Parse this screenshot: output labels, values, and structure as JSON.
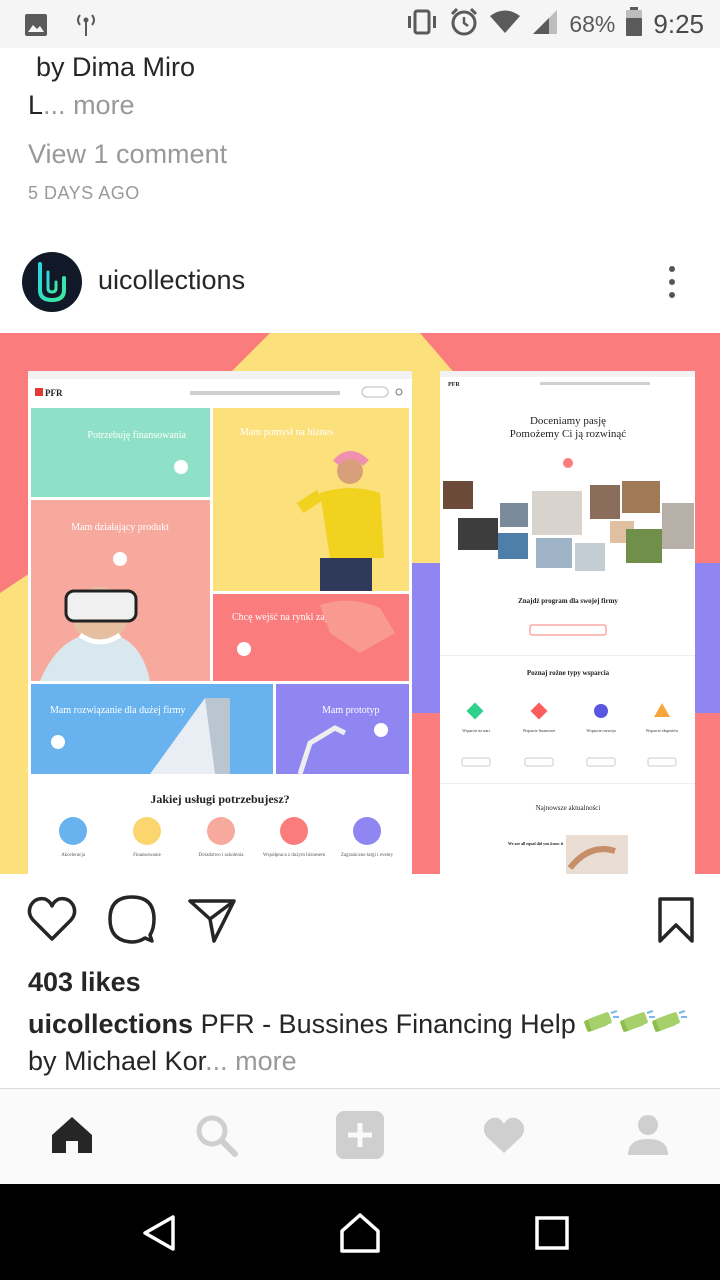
{
  "status_bar": {
    "battery": "68%",
    "time": "9:25",
    "icons": [
      "image-icon",
      "signal-antenna-icon",
      "vibrate-icon",
      "alarm-icon",
      "wifi-icon",
      "cell-signal-icon",
      "battery-icon"
    ]
  },
  "previous_post": {
    "author_line": "by Dima Miro",
    "truncated_text": "L",
    "ellipsis": "...",
    "more_label": "more",
    "view_comments": "View 1 comment",
    "age": "5 DAYS AGO"
  },
  "post": {
    "username": "uicollections",
    "likes": "403 likes",
    "caption_user": "uicollections",
    "caption_text": "PFR - Bussines Financing Help",
    "caption_line2": "by Michael Kor",
    "ellipsis": "...",
    "more_label": "more",
    "image": {
      "left_mockup": {
        "logo": "PFR",
        "tiles": [
          "Potrzebuję finansowania",
          "Mam pomysł na biznes",
          "Mam działający produkt",
          "Chcę wejść na rynki zagraniczne",
          "Mam rozwiązanie dla dużej firmy",
          "Mam prototyp"
        ],
        "question": "Jakiej usługi potrzebujesz?",
        "services": [
          "Akceleracja",
          "Finansowanie",
          "Doradztwo i szkolenia",
          "Współpraca z dużym biznesem",
          "Zagraniczne targi i eventy"
        ]
      },
      "right_mockup": {
        "logo": "PFR",
        "heading1": "Doceniamy pasję",
        "heading2": "Pomożemy Ci ją rozwinąć",
        "section1": "Znajdź program dla swojej firmy",
        "section2": "Poznaj rożne typy wsparcia",
        "support_types": [
          "Wsparcie na start",
          "Wsparcie finansowe",
          "Wsparcie rozwoju",
          "Wsparcie ekspertów"
        ],
        "section3": "Najnowsze aktualności",
        "news_title": "We are all equal did you know it"
      }
    }
  },
  "tab_bar": {
    "items": [
      "home-icon",
      "search-icon",
      "add-post-icon",
      "activity-heart-icon",
      "profile-icon"
    ]
  },
  "nav_bar": {
    "items": [
      "back-icon",
      "home-icon",
      "recents-icon"
    ]
  },
  "colors": {
    "accent_text": "#262626",
    "muted_text": "#999999",
    "image_pink": "#fb7c7c",
    "image_yellow": "#fbe07c",
    "image_purple": "#8f86f2",
    "tile_mint": "#8ee0c6",
    "tile_blue": "#67b2ef",
    "tile_peach": "#f8a99e"
  }
}
